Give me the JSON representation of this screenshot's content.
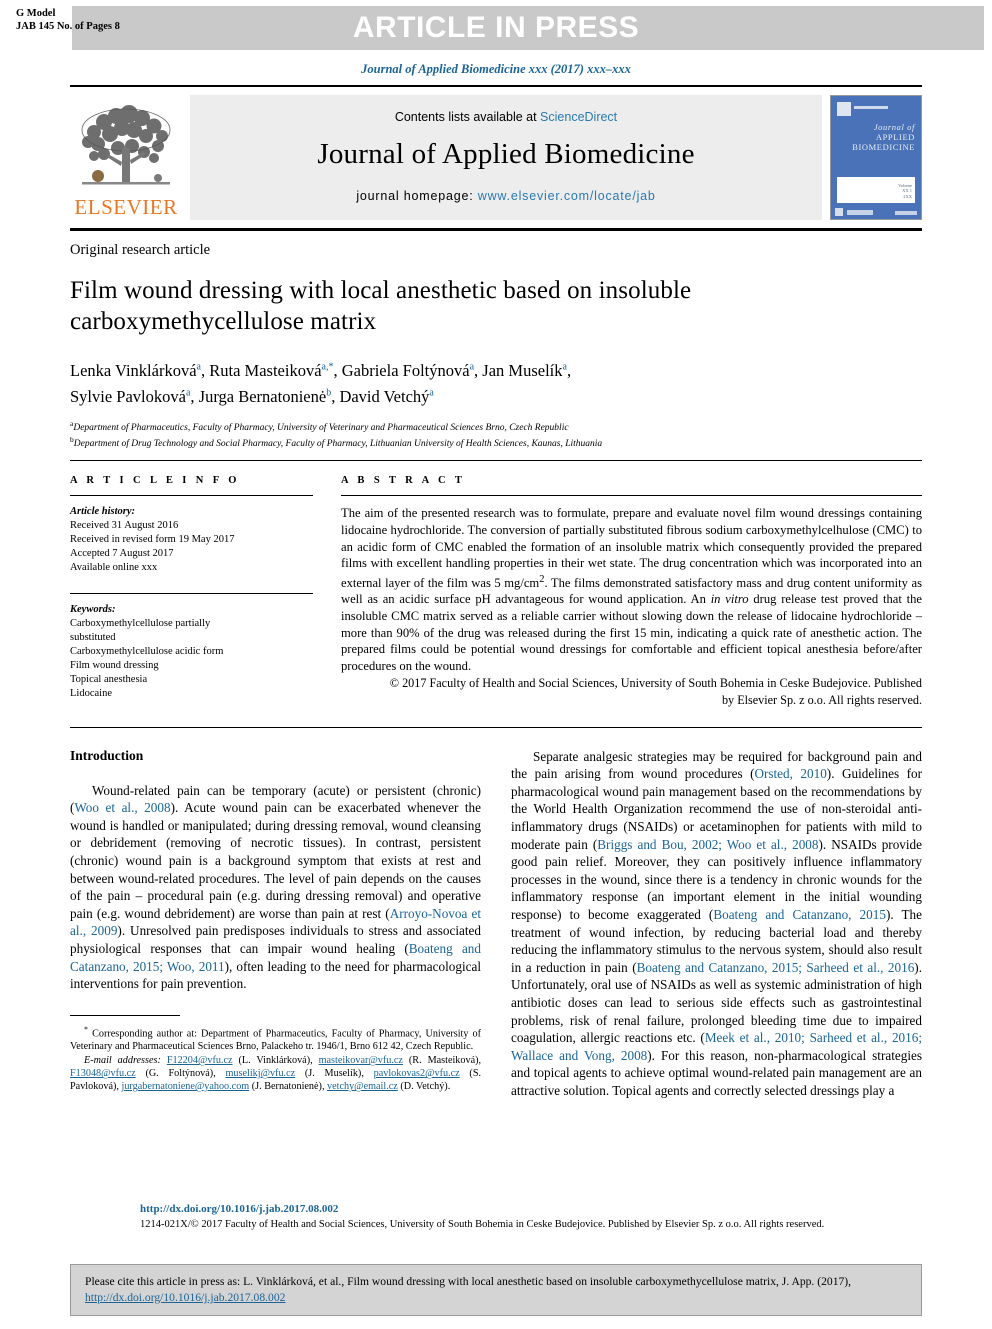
{
  "banner": {
    "gmodel_line1": "G Model",
    "gmodel_line2": "JAB 145 No. of Pages 8",
    "press_label": "ARTICLE IN PRESS",
    "journal_ref": "Journal of Applied Biomedicine xxx (2017) xxx–xxx"
  },
  "masthead": {
    "publisher_name": "ELSEVIER",
    "contents_prefix": "Contents lists available at ",
    "contents_link": "ScienceDirect",
    "journal_title": "Journal of Applied Biomedicine",
    "homepage_prefix": "journal homepage: ",
    "homepage_url": "www.elsevier.com/locate/jab",
    "cover_title_line1": "Journal of",
    "cover_title_line2": "APPLIED",
    "cover_title_line3": "BIOMEDICINE",
    "cover_vol_line1": "Volume",
    "cover_vol_line2": "XX 1",
    "cover_vol_line3": "2XX"
  },
  "article": {
    "type": "Original research article",
    "title": "Film wound dressing with local anesthetic based on insoluble carboxymethycellulose matrix",
    "authors_line1": [
      {
        "name": "Lenka Vinklárková",
        "sup": "a"
      },
      {
        "name": "Ruta Masteiková",
        "sup": "a,*"
      },
      {
        "name": "Gabriela Foltýnová",
        "sup": "a"
      },
      {
        "name": "Jan Muselík",
        "sup": "a"
      }
    ],
    "authors_line2": [
      {
        "name": "Sylvie Pavloková",
        "sup": "a"
      },
      {
        "name": "Jurga Bernatonienė",
        "sup": "b"
      },
      {
        "name": "David Vetchý",
        "sup": "a"
      }
    ],
    "affiliations": [
      {
        "sup": "a",
        "text": "Department of Pharmaceutics, Faculty of Pharmacy, University of Veterinary and Pharmaceutical Sciences Brno, Czech Republic"
      },
      {
        "sup": "b",
        "text": "Department of Drug Technology and Social Pharmacy, Faculty of Pharmacy, Lithuanian University of Health Sciences, Kaunas, Lithuania"
      }
    ]
  },
  "article_info": {
    "heading": "A R T I C L E   I N F O",
    "history_label": "Article history:",
    "history": [
      "Received 31 August 2016",
      "Received in revised form 19 May 2017",
      "Accepted 7 August 2017",
      "Available online xxx"
    ],
    "keywords_label": "Keywords:",
    "keywords": [
      "Carboxymethylcellulose partially",
      "substituted",
      "Carboxymethylcellulose acidic form",
      "Film wound dressing",
      "Topical anesthesia",
      "Lidocaine"
    ]
  },
  "abstract": {
    "heading": "A B S T R A C T",
    "body_part1": "The aim of the presented research was to formulate, prepare and evaluate novel film wound dressings containing lidocaine hydrochloride. The conversion of partially substituted fibrous sodium carboxymethylcelhulose (CMC) to an acidic form of CMC enabled the formation of an insoluble matrix which consequently provided the prepared films with excellent handling properties in their wet state. The drug concentration which was incorporated into an external layer of the film was 5 mg/cm",
    "superscript": "2",
    "body_part2": ". The films demonstrated satisfactory mass and drug content uniformity as well as an acidic surface pH advantageous for wound application. An ",
    "italic_term": "in vitro",
    "body_part3": " drug release test proved that the insoluble CMC matrix served as a reliable carrier without slowing down the release of lidocaine hydrochloride – more than 90% of the drug was released during the first 15 min, indicating a quick rate of anesthetic action. The prepared films could be potential wound dressings for comfortable and efficient topical anesthesia before/after procedures on the wound.",
    "copyright_line1": "© 2017 Faculty of Health and Social Sciences, University of South Bohemia in Ceske Budejovice. Published",
    "copyright_line2": "by Elsevier Sp. z o.o. All rights reserved."
  },
  "introduction": {
    "heading": "Introduction",
    "left_p1_a": "Wound-related pain can be temporary (acute) or persistent (chronic) (",
    "left_p1_ref1": "Woo et al., 2008",
    "left_p1_b": "). Acute wound pain can be exacerbated whenever the wound is handled or manipulated; during dressing removal, wound cleansing or debridement (removing of necrotic tissues). In contrast, persistent (chronic) wound pain is a background symptom that exists at rest and between wound-related procedures. The level of pain depends on the causes of the pain – procedural pain (e.g. during dressing removal) and operative pain (e.g. wound debridement) are worse than pain at rest (",
    "left_p1_ref2": "Arroyo-Novoa et al., 2009",
    "left_p1_c": "). Unresolved pain predisposes individuals to stress and associated physiological responses that can impair wound healing (",
    "left_p1_ref3": "Boateng and Catanzano, 2015; Woo, 2011",
    "left_p1_d": "), often leading to the need for pharmacological interventions for pain prevention.",
    "right_p1_a": "Separate analgesic strategies may be required for background pain and the pain arising from wound procedures (",
    "right_p1_ref1": "Orsted, 2010",
    "right_p1_b": "). Guidelines for pharmacological wound pain management based on the recommendations by the World Health Organization recommend the use of non-steroidal anti-inflammatory drugs (NSAIDs) or acetaminophen for patients with mild to moderate pain (",
    "right_p1_ref2": "Briggs and Bou, 2002; Woo et al., 2008",
    "right_p1_c": "). NSAIDs provide good pain relief. Moreover, they can positively influence inflammatory processes in the wound, since there is a tendency in chronic wounds for the inflammatory response (an important element in the initial wounding response) to become exaggerated (",
    "right_p1_ref3": "Boateng and Catanzano, 2015",
    "right_p1_d": "). The treatment of wound infection, by reducing bacterial load and thereby reducing the inflammatory stimulus to the nervous system, should also result in a reduction in pain (",
    "right_p1_ref4": "Boateng and Catanzano, 2015; Sarheed et al., 2016",
    "right_p1_e": "). Unfortunately, oral use of NSAIDs as well as systemic administration of high antibiotic doses can lead to serious side effects such as gastrointestinal problems, risk of renal failure, prolonged bleeding time due to impaired coagulation, allergic reactions etc. (",
    "right_p1_ref5": "Meek et al., 2010; Sarheed et al., 2016; Wallace and Vong, 2008",
    "right_p1_f": "). For this reason, non-pharmacological strategies and topical agents to achieve optimal wound-related pain management are an attractive solution. Topical agents and correctly selected dressings play a"
  },
  "footnote": {
    "corresponding_marker": "*",
    "corresponding": "Corresponding author at: Department of Pharmaceutics, Faculty of Pharmacy, University of Veterinary and Pharmaceutical Sciences Brno, Palackeho tr. 1946/1, Brno 612 42, Czech Republic.",
    "email_label": "E-mail addresses:",
    "emails": [
      {
        "address": "F12204@vfu.cz",
        "person": "(L. Vinklárková)"
      },
      {
        "address": "masteikovar@vfu.cz",
        "person": "(R. Masteiková)"
      },
      {
        "address": "F13048@vfu.cz",
        "person": "(G. Foltýnová)"
      },
      {
        "address": "muselikj@vfu.cz",
        "person": "(J. Muselík)"
      },
      {
        "address": "pavlokovas2@vfu.cz",
        "person": "(S. Pavloková)"
      },
      {
        "address": "jurgabernatoniene@yahoo.com",
        "person": "(J. Bernatonienė)"
      },
      {
        "address": "vetchy@email.cz",
        "person": "(D. Vetchý)"
      }
    ]
  },
  "footer": {
    "doi": "http://dx.doi.org/10.1016/j.jab.2017.08.002",
    "issn_line": "1214-021X/© 2017 Faculty of Health and Social Sciences, University of South Bohemia in Ceske Budejovice. Published by Elsevier Sp. z o.o. All rights reserved."
  },
  "citation_box": {
    "text_a": "Please cite this article in press as: L. Vinklárková, et al., Film wound dressing with local anesthetic based on insoluble carboxymethycellulose matrix, J. App. (2017), ",
    "link": "http://dx.doi.org/10.1016/j.jab.2017.08.002"
  },
  "colors": {
    "link": "#1a6496",
    "elsevier_orange": "#E87722",
    "banner_gray": "#c9c9c9",
    "masthead_gray": "#ededed",
    "cite_box_gray": "#d4d4d4",
    "cover_blue": "#4a72b8"
  }
}
